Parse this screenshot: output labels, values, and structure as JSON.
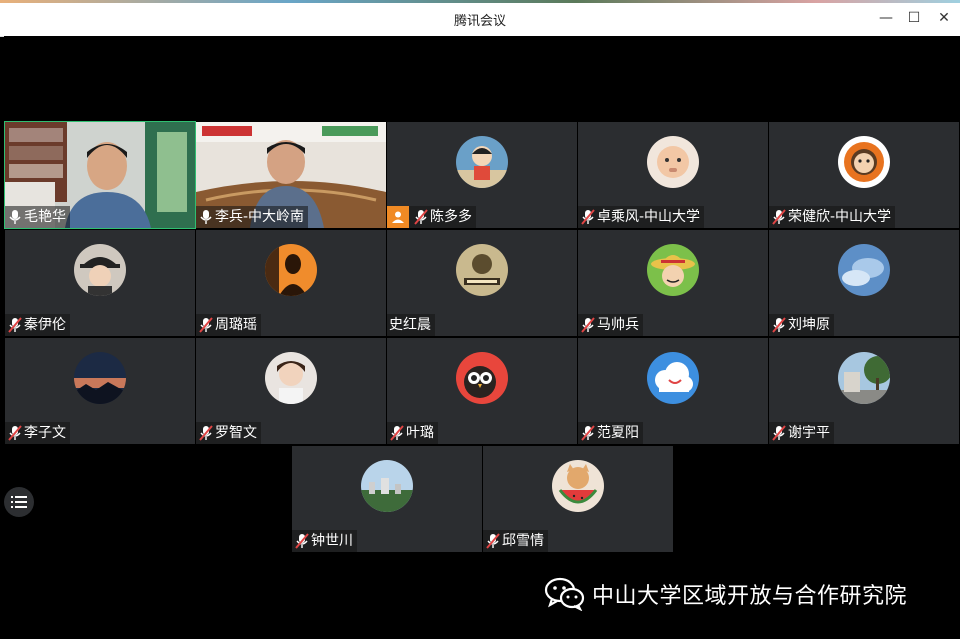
{
  "window": {
    "title": "腾讯会议",
    "minimize": "—",
    "maximize": "☐",
    "close": "✕"
  },
  "participants": [
    {
      "name": "毛艳华",
      "avatar": "video-man-office",
      "muted": false
    },
    {
      "name": "李兵-中大岭南",
      "avatar": "video-man-room",
      "muted": false
    },
    {
      "name": "陈多多",
      "avatar": "cartoon-child",
      "muted": true,
      "host": true
    },
    {
      "name": "卓乘风-中山大学",
      "avatar": "baby",
      "muted": true
    },
    {
      "name": "荣健欣-中山大学",
      "avatar": "cartoon-orange-hood",
      "muted": true
    },
    {
      "name": "秦伊伦",
      "avatar": "girl-hat",
      "muted": true
    },
    {
      "name": "周璐瑶",
      "avatar": "silhouette-warm",
      "muted": true
    },
    {
      "name": "史红晨",
      "avatar": "text-icon",
      "muted": false
    },
    {
      "name": "马帅兵",
      "avatar": "straw-hat-cartoon",
      "muted": true
    },
    {
      "name": "刘坤原",
      "avatar": "blue-sky",
      "muted": true
    },
    {
      "name": "李子文",
      "avatar": "sunset",
      "muted": true
    },
    {
      "name": "罗智文",
      "avatar": "girl-smile",
      "muted": true
    },
    {
      "name": "叶璐",
      "avatar": "cartoon-owl",
      "muted": true
    },
    {
      "name": "范夏阳",
      "avatar": "cloud-face",
      "muted": true
    },
    {
      "name": "谢宇平",
      "avatar": "street-trees",
      "muted": true
    },
    {
      "name": "钟世川",
      "avatar": "city-view",
      "muted": true
    },
    {
      "name": "邱雪情",
      "avatar": "cat-watermelon",
      "muted": true
    }
  ],
  "watermark": {
    "text": "中山大学区域开放与合作研究院",
    "icon": "wechat-icon"
  },
  "colors": {
    "tile_bg": "#2b2d30",
    "active_border": "#2fbf71",
    "host_badge": "#f08a24",
    "mic_muted": "#e04545"
  }
}
